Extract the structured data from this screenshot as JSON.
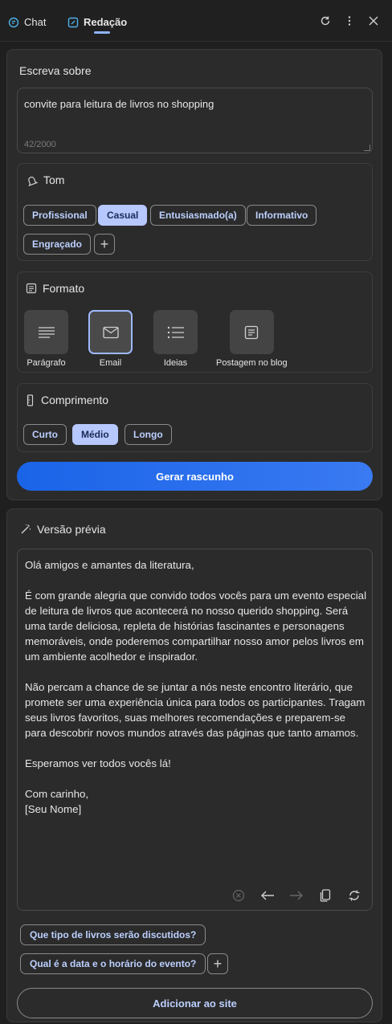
{
  "tabs": [
    {
      "label": "Chat",
      "icon": "chat-icon"
    },
    {
      "label": "Redação",
      "icon": "compose-icon",
      "active": true
    }
  ],
  "top_actions": [
    "refresh-icon",
    "more-icon",
    "close-icon"
  ],
  "compose": {
    "label": "Escreva sobre",
    "value": "convite para leitura de livros no shopping",
    "counter": "42/2000"
  },
  "tone": {
    "title": "Tom",
    "options": [
      "Profissional",
      "Casual",
      "Entusiasmado(a)",
      "Informativo",
      "Engraçado"
    ],
    "selected": "Casual"
  },
  "format": {
    "title": "Formato",
    "options": [
      "Parágrafo",
      "Email",
      "Ideias",
      "Postagem no blog"
    ],
    "selected": "Email"
  },
  "length": {
    "title": "Comprimento",
    "options": [
      "Curto",
      "Médio",
      "Longo"
    ],
    "selected": "Médio"
  },
  "generate_label": "Gerar rascunho",
  "preview": {
    "title": "Versão prévia",
    "paragraphs": [
      "Olá amigos e amantes da literatura,",
      "É com grande alegria que convido todos vocês para um evento especial de leitura de livros que acontecerá no nosso querido shopping. Será uma tarde deliciosa, repleta de histórias fascinantes e personagens memoráveis, onde poderemos compartilhar nosso amor pelos livros em um ambiente acolhedor e inspirador.",
      "Não percam a chance de se juntar a nós neste encontro literário, que promete ser uma experiência única para todos os participantes. Tragam seus livros favoritos, suas melhores recomendações e preparem-se para descobrir novos mundos através das páginas que tanto amamos.",
      "Esperamos ver todos vocês lá!",
      "Com carinho,",
      "[Seu Nome]"
    ]
  },
  "suggestions": [
    "Que tipo de livros serão discutidos?",
    "Qual é a data e o horário do evento?"
  ],
  "add_to_site_label": "Adicionar ao site",
  "colors": {
    "accent": "#1a64e8",
    "chip_selected": "#b7c8ff",
    "chip_text": "#bcd0ff"
  }
}
